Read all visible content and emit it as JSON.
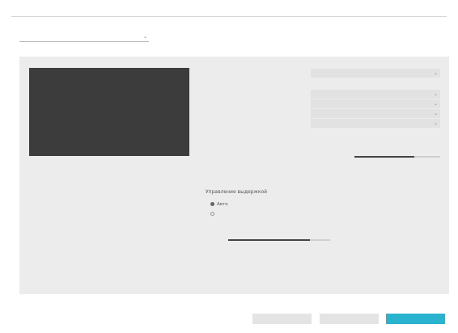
{
  "title": "",
  "top_select": {
    "value": ""
  },
  "info": {
    "line1": "",
    "line2": ""
  },
  "settings": {
    "rows": [
      {
        "label": "",
        "value": ""
      },
      {
        "label": ""
      },
      {
        "label": "",
        "value": ""
      },
      {
        "label": "",
        "value": ""
      },
      {
        "label": "",
        "value": ""
      },
      {
        "label": "",
        "value": ""
      },
      {
        "label": ""
      }
    ],
    "slider_value_label": ""
  },
  "exposure": {
    "heading": "Управление выдержкой",
    "option_auto": "Авто",
    "option_manual": "",
    "manual_value_label": ""
  },
  "buttons": {
    "first": "",
    "second": "",
    "third": ""
  },
  "colors": {
    "accent": "#2ab3cf",
    "panel": "#ececec",
    "preview": "#3c3c3c"
  },
  "icons": {
    "select_arrow": "chevron-down-icon"
  },
  "levels": {
    "main_slider": 0.7,
    "manual_slider": 0.8
  }
}
